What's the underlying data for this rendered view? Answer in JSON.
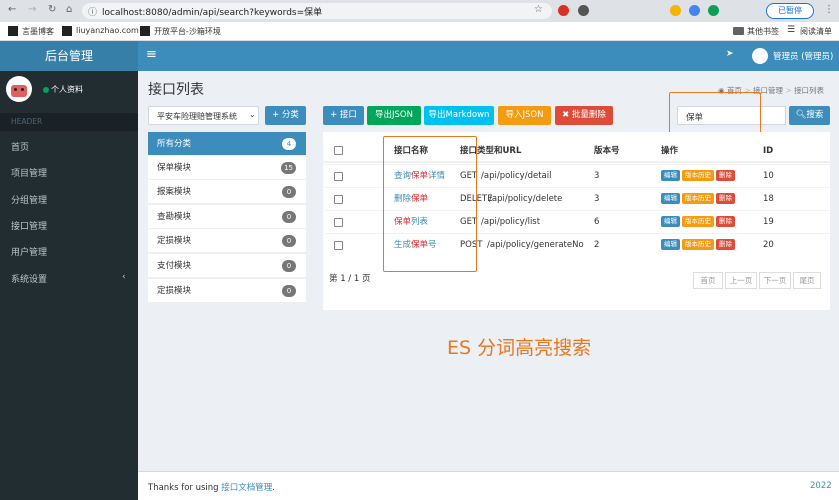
{
  "browser": {
    "url": "localhost:8080/admin/api/search?keywords=保单",
    "profile_label": "已暂停",
    "bookmarks": [
      "言墨博客",
      "liuyanzhao.com",
      "开放平台-沙箱环境"
    ],
    "other_bookmarks": "其他书签",
    "reading_list": "阅读清单"
  },
  "sidebar": {
    "brand": "后台管理",
    "profile_label": "个人资料",
    "header": "HEADER",
    "items": [
      {
        "label": "首页"
      },
      {
        "label": "项目管理"
      },
      {
        "label": "分组管理"
      },
      {
        "label": "接口管理"
      },
      {
        "label": "用户管理"
      },
      {
        "label": "系统设置"
      }
    ]
  },
  "navbar": {
    "menu_glyph": "≡",
    "user": "管理员 (管理员)"
  },
  "page": {
    "title": "接口列表",
    "breadcrumb": [
      "首页",
      "接口管理",
      "接口列表"
    ]
  },
  "project_select": "平安车险理赔管理系统",
  "add_category_label": "+ 分类",
  "categories": [
    {
      "name": "所有分类",
      "count": "4"
    },
    {
      "name": "保单模块",
      "count": "15"
    },
    {
      "name": "报案模块",
      "count": "0"
    },
    {
      "name": "查勘模块",
      "count": "0"
    },
    {
      "name": "定损模块",
      "count": "0"
    },
    {
      "name": "支付模块",
      "count": "0"
    },
    {
      "name": "定损模块",
      "count": "0"
    }
  ],
  "toolbar": {
    "add": "+ 接口",
    "export_json": "导出JSON",
    "export_md": "导出Markdown",
    "import_json": "导入JSON",
    "batch_delete": "✖ 批量删除"
  },
  "search": {
    "value": "保单",
    "button": "搜索"
  },
  "table": {
    "headers": [
      "接口名称",
      "接口类型和URL",
      "版本号",
      "操作",
      "ID"
    ],
    "rows": [
      {
        "name_pre": "查询",
        "name_hl": "保单",
        "name_post": "详情",
        "method": "GET",
        "url": "/api/policy/detail",
        "version": "3",
        "id": "10"
      },
      {
        "name_pre": "删除",
        "name_hl": "保单",
        "name_post": "",
        "method": "DELETE",
        "url": "/api/policy/delete",
        "version": "3",
        "id": "18"
      },
      {
        "name_pre": "",
        "name_hl": "保单",
        "name_post": "列表",
        "method": "GET",
        "url": "/api/policy/list",
        "version": "6",
        "id": "19"
      },
      {
        "name_pre": "生成",
        "name_hl": "保单",
        "name_post": "号",
        "method": "POST",
        "url": "/api/policy/generateNo",
        "version": "2",
        "id": "20"
      }
    ],
    "actions": {
      "edit": "编辑",
      "history": "版本历史",
      "delete": "删除"
    }
  },
  "pagination": {
    "info": "第 1 / 1 页",
    "buttons": [
      "首页",
      "上一页",
      "下一页",
      "尾页"
    ]
  },
  "annotation": "ES 分词高亮搜索",
  "footer": {
    "text": "Thanks for using ",
    "link": "接口文档管理",
    "suffix": ".",
    "year": "2022"
  },
  "colors": {
    "sidebar_bg": "#222d32",
    "navbar_bg": "#3c8dbc",
    "brand_bg": "#367fa9",
    "highlight_red": "#e5242b",
    "annotation_box": "#e8781e"
  }
}
